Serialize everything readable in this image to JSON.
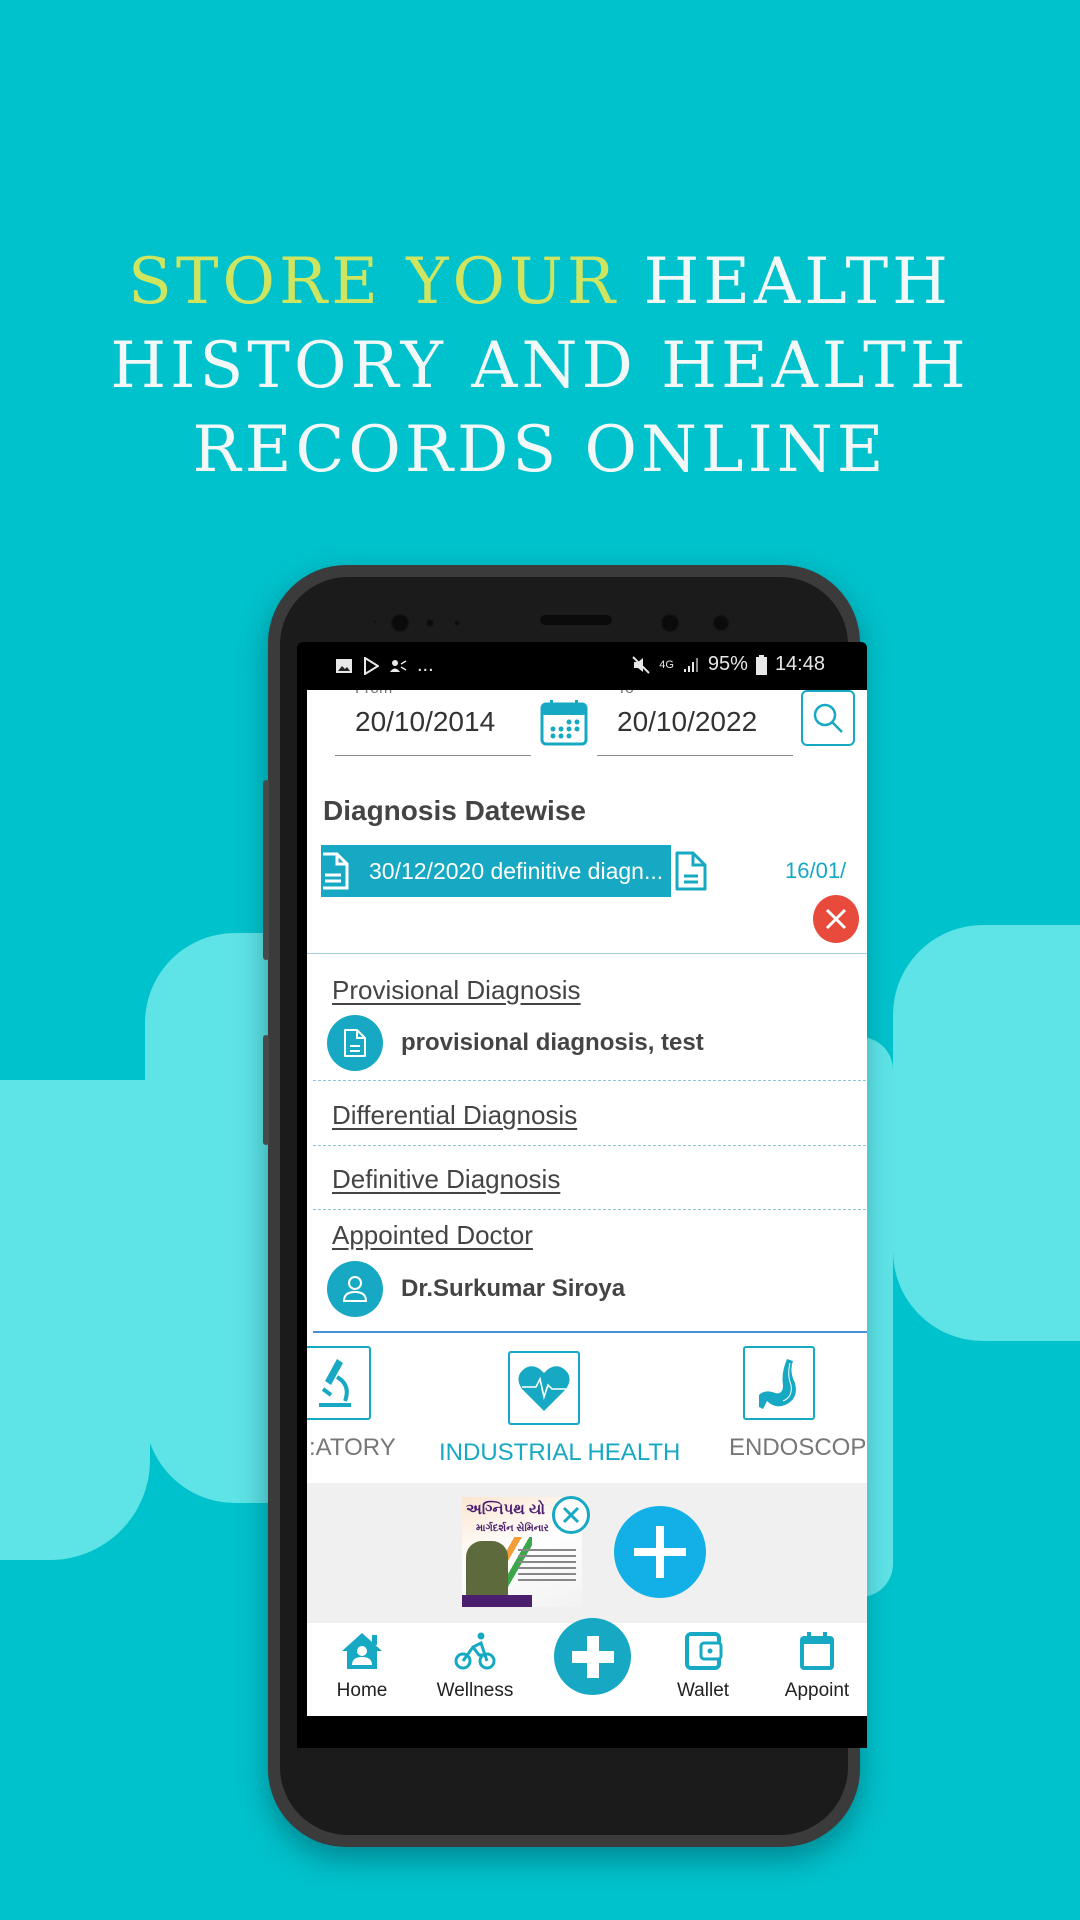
{
  "promo": {
    "headline_highlight": "STORE YOUR",
    "headline_line1_rest": "HEALTH",
    "headline_line2": "HISTORY AND HEALTH",
    "headline_line3": "RECORDS ONLINE",
    "colors": {
      "background": "#00c2cc",
      "blob": "#5ee3e6",
      "highlight": "#cfe560"
    }
  },
  "status_bar": {
    "left_icons": [
      "image-icon",
      "play-store-icon",
      "contacts-icon"
    ],
    "more": "...",
    "network": "4G",
    "battery": "95%",
    "time": "14:48"
  },
  "filters": {
    "from_label": "From",
    "from_value": "20/10/2014",
    "to_label": "To",
    "to_value": "20/10/2022"
  },
  "diagnosis": {
    "section_title": "Diagnosis Datewise",
    "active_chip": "30/12/2020 definitive diagn...",
    "next_chip_date": "16/01/",
    "provisional_title": "Provisional Diagnosis",
    "provisional_value": "provisional diagnosis,  test",
    "differential_title": "Differential Diagnosis",
    "definitive_title": "Definitive Diagnosis",
    "doctor_title": "Appointed Doctor",
    "doctor_name": "Dr.Surkumar Siroya"
  },
  "categories": [
    {
      "label": "LABORATORY",
      "visible_label": ":ATORY",
      "icon": "microscope-icon",
      "active": false
    },
    {
      "label": "INDUSTRIAL HEALTH",
      "icon": "heart-pulse-icon",
      "active": true
    },
    {
      "label": "ENDOSCOPY",
      "icon": "stomach-icon",
      "active": false
    }
  ],
  "ad": {
    "title": "અગ્નિપથ યો",
    "subtitle": "માર્ગદર્શન સેમિનાર"
  },
  "bottom_nav": [
    {
      "label": "Home",
      "icon": "home-icon"
    },
    {
      "label": "Wellness",
      "icon": "cycling-icon"
    },
    {
      "label": "",
      "icon": "plus-icon"
    },
    {
      "label": "Wallet",
      "icon": "wallet-icon"
    },
    {
      "label": "Appoint",
      "icon": "calendar-icon"
    }
  ],
  "accent_color": "#17a9c3"
}
